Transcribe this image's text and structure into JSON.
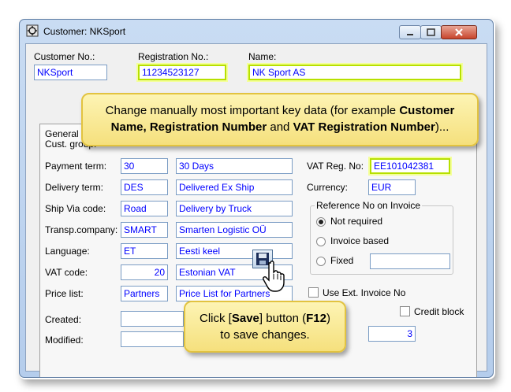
{
  "window": {
    "title": "Customer: NKSport"
  },
  "header": {
    "customer_no": {
      "label": "Customer No.:",
      "value": "NKSport"
    },
    "registration_no": {
      "label": "Registration No.:",
      "value": "11234523127"
    },
    "name": {
      "label": "Name:",
      "value": "NK Sport AS"
    }
  },
  "tabs": {
    "general": "General"
  },
  "form": {
    "cust_group_label": "Cust. group:",
    "payment_term": {
      "label": "Payment term:",
      "code": "30",
      "desc": "30 Days"
    },
    "delivery_term": {
      "label": "Delivery term:",
      "code": "DES",
      "desc": "Delivered Ex Ship"
    },
    "ship_via": {
      "label": "Ship Via code:",
      "code": "Road",
      "desc": "Delivery by Truck"
    },
    "transp_company": {
      "label": "Transp.company:",
      "code": "SMART",
      "desc": "Smarten Logistic OÜ"
    },
    "language": {
      "label": "Language:",
      "code": "ET",
      "desc": "Eesti keel"
    },
    "vat_code": {
      "label": "VAT code:",
      "code": "20",
      "desc": "Estonian VAT"
    },
    "price_list": {
      "label": "Price list:",
      "code": "Partners",
      "desc": "Price List for Partners"
    },
    "created": {
      "label": "Created:"
    },
    "modified": {
      "label": "Modified:"
    },
    "vat_reg": {
      "label": "VAT Reg. No:",
      "value": "EE101042381"
    },
    "currency": {
      "label": "Currency:",
      "value": "EUR"
    },
    "reference": {
      "title": "Reference No on Invoice",
      "not_required": "Not required",
      "invoice_based": "Invoice based",
      "fixed": "Fixed",
      "selected": "Not required"
    },
    "use_ext_invoice": "Use Ext. Invoice No",
    "credit_block": "Credit block",
    "count_value": "3"
  },
  "callouts": {
    "top": {
      "line1": "Change manually most important key data (for example ",
      "b1": "Customer",
      "b2": "Name, Registration Number",
      "and": " and ",
      "b3": "VAT Registration Number",
      "end": ")..."
    },
    "bottom": {
      "pre": "Click [",
      "save": "Save",
      "mid": "] button (",
      "key": "F12",
      "post": ")",
      "line2": "to save changes."
    }
  },
  "colors": {
    "highlight": "#b7e000",
    "field_text": "#0000ff",
    "callout": "#f7e58b"
  }
}
